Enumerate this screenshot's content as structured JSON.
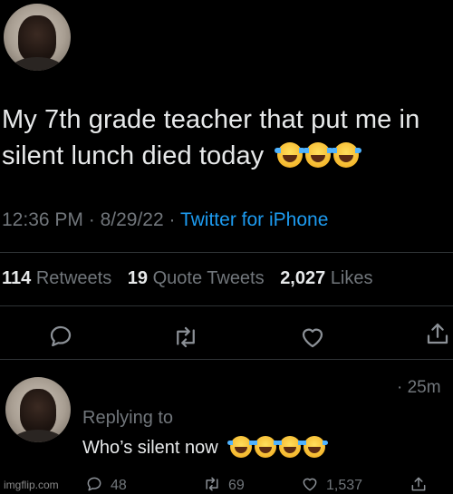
{
  "tweet": {
    "text_line1": "My 7th grade teacher that put me in",
    "text_line2": "silent lunch died today",
    "time": "12:36 PM",
    "date": "8/29/22",
    "source": "Twitter for iPhone",
    "separator": "·",
    "stats": {
      "retweets_count": "114",
      "retweets_label": "Retweets",
      "quote_count": "19",
      "quote_label": "Quote Tweets",
      "likes_count": "2,027",
      "likes_label": "Likes"
    }
  },
  "reply": {
    "time": "· 25m",
    "replying_to": "Replying to",
    "text": "Who’s silent now",
    "counts": {
      "reply": "48",
      "retweet": "69",
      "like": "1,537"
    }
  },
  "watermark": "imgflip.com",
  "colors": {
    "background": "#000000",
    "text": "#e7e9ea",
    "muted": "#71767b",
    "link": "#1d9bf0",
    "divider": "#2f3336"
  },
  "icons": {
    "reply": "reply-icon",
    "retweet": "retweet-icon",
    "like": "heart-icon",
    "share": "share-icon",
    "emoji": "face-with-tears-of-joy"
  }
}
